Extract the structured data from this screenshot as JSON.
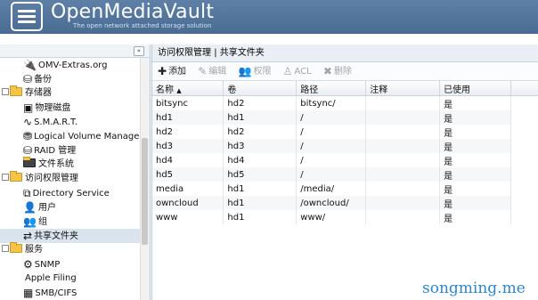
{
  "header": {
    "brand": "OpenMediaVault",
    "tagline": "The open network attached storage solution"
  },
  "sidebar": {
    "collapse_label": "«",
    "items": [
      {
        "label": "OMV-Extras.org",
        "level": 1,
        "icon": "plug-icon"
      },
      {
        "label": "备份",
        "level": 1,
        "icon": "backup-icon"
      },
      {
        "label": "存储器",
        "level": 0,
        "icon": "folder-icon"
      },
      {
        "label": "物理磁盘",
        "level": 1,
        "icon": "disk-icon"
      },
      {
        "label": "S.M.A.R.T.",
        "level": 1,
        "icon": "pulse-icon"
      },
      {
        "label": "Logical Volume Manageme",
        "level": 1,
        "icon": "lvm-icon"
      },
      {
        "label": "RAID 管理",
        "level": 1,
        "icon": "raid-icon"
      },
      {
        "label": "文件系统",
        "level": 1,
        "icon": "filesystem-icon"
      },
      {
        "label": "访问权限管理",
        "level": 0,
        "icon": "folder-icon"
      },
      {
        "label": "Directory Service",
        "level": 1,
        "icon": "directory-icon"
      },
      {
        "label": "用户",
        "level": 1,
        "icon": "user-icon"
      },
      {
        "label": "组",
        "level": 1,
        "icon": "group-icon"
      },
      {
        "label": "共享文件夹",
        "level": 1,
        "icon": "shared-folder-icon",
        "selected": true
      },
      {
        "label": "服务",
        "level": 0,
        "icon": "folder-icon"
      },
      {
        "label": "SNMP",
        "level": 1,
        "icon": "snmp-icon"
      },
      {
        "label": "Apple Filing",
        "level": 1,
        "icon": "apple-icon"
      },
      {
        "label": "SMB/CIFS",
        "level": 1,
        "icon": "smb-icon"
      }
    ]
  },
  "breadcrumb": {
    "part1": "访问权限管理",
    "separator": "|",
    "part2": "共享文件夹"
  },
  "toolbar": {
    "add": "添加",
    "edit": "编辑",
    "permissions": "权限",
    "acl": "ACL",
    "delete": "删除"
  },
  "grid": {
    "columns": [
      "名称",
      "卷",
      "路径",
      "注释",
      "已使用"
    ],
    "sort_indicator": "▲",
    "rows": [
      {
        "name": "bitsync",
        "volume": "hd2",
        "path": "bitsync/",
        "comment": "",
        "used": "是"
      },
      {
        "name": "hd1",
        "volume": "hd1",
        "path": "/",
        "comment": "",
        "used": "是"
      },
      {
        "name": "hd2",
        "volume": "hd2",
        "path": "/",
        "comment": "",
        "used": "是"
      },
      {
        "name": "hd3",
        "volume": "hd3",
        "path": "/",
        "comment": "",
        "used": "是"
      },
      {
        "name": "hd4",
        "volume": "hd4",
        "path": "/",
        "comment": "",
        "used": "是"
      },
      {
        "name": "hd5",
        "volume": "hd5",
        "path": "/",
        "comment": "",
        "used": "是"
      },
      {
        "name": "media",
        "volume": "hd1",
        "path": "/media/",
        "comment": "",
        "used": "是"
      },
      {
        "name": "owncloud",
        "volume": "hd1",
        "path": "/owncloud/",
        "comment": "",
        "used": "是"
      },
      {
        "name": "www",
        "volume": "hd1",
        "path": "www/",
        "comment": "",
        "used": "是"
      }
    ]
  },
  "watermark": "songming.me",
  "colors": {
    "header": "#4f7198",
    "selection": "#d9e4ef",
    "watermark": "#2f86c8"
  }
}
